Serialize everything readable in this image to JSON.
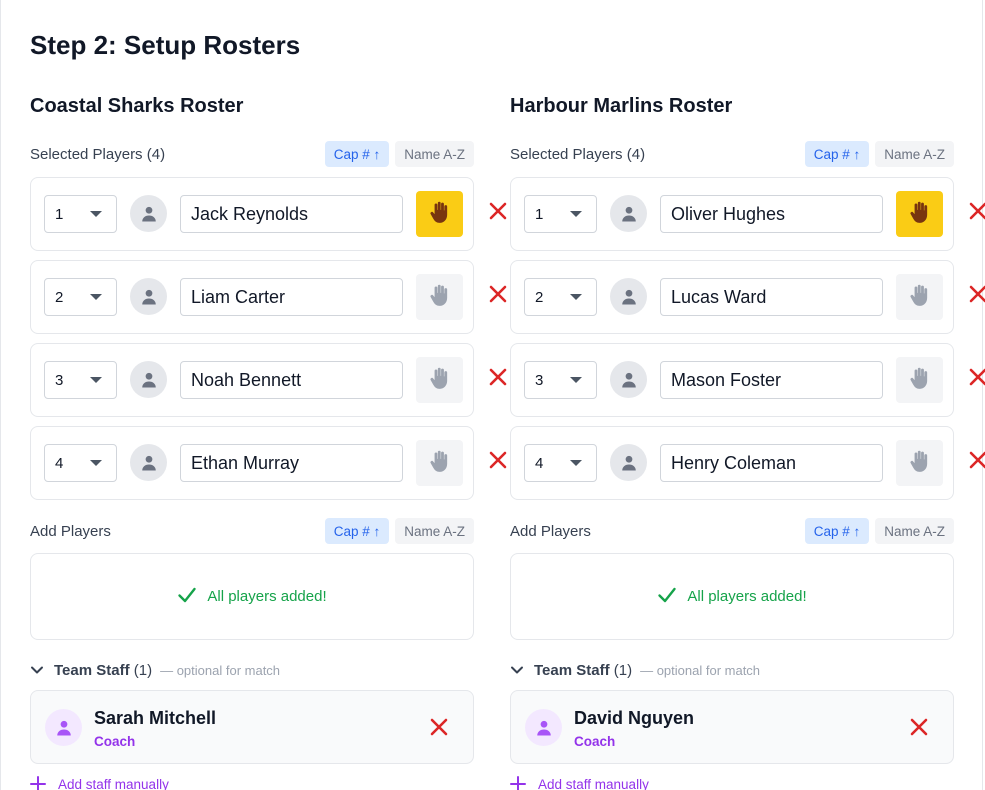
{
  "page_title": "Step 2: Setup Rosters",
  "teams": [
    {
      "title": "Coastal Sharks Roster",
      "selected_label": "Selected Players (4)",
      "add_label": "Add Players",
      "sort_cap": "Cap # ↑",
      "sort_name": "Name A-Z",
      "players": [
        {
          "number": "1",
          "name": "Jack Reynolds",
          "captain": true
        },
        {
          "number": "2",
          "name": "Liam Carter",
          "captain": false
        },
        {
          "number": "3",
          "name": "Noah Bennett",
          "captain": false
        },
        {
          "number": "4",
          "name": "Ethan Murray",
          "captain": false
        }
      ],
      "all_added": "All players added!",
      "staff_title": "Team Staff",
      "staff_count": "(1)",
      "staff_optional": "— optional for match",
      "staff": [
        {
          "name": "Sarah Mitchell",
          "role": "Coach"
        }
      ],
      "add_staff": "Add staff manually"
    },
    {
      "title": "Harbour Marlins Roster",
      "selected_label": "Selected Players (4)",
      "add_label": "Add Players",
      "sort_cap": "Cap # ↑",
      "sort_name": "Name A-Z",
      "players": [
        {
          "number": "1",
          "name": "Oliver Hughes",
          "captain": true
        },
        {
          "number": "2",
          "name": "Lucas Ward",
          "captain": false
        },
        {
          "number": "3",
          "name": "Mason Foster",
          "captain": false
        },
        {
          "number": "4",
          "name": "Henry Coleman",
          "captain": false
        }
      ],
      "all_added": "All players added!",
      "staff_title": "Team Staff",
      "staff_count": "(1)",
      "staff_optional": "— optional for match",
      "staff": [
        {
          "name": "David Nguyen",
          "role": "Coach"
        }
      ],
      "add_staff": "Add staff manually"
    }
  ],
  "colors": {
    "captain_active": "#facc15",
    "remove": "#dc2626",
    "success": "#16a34a",
    "staff_accent": "#9333ea",
    "sort_active": "#2563eb"
  }
}
